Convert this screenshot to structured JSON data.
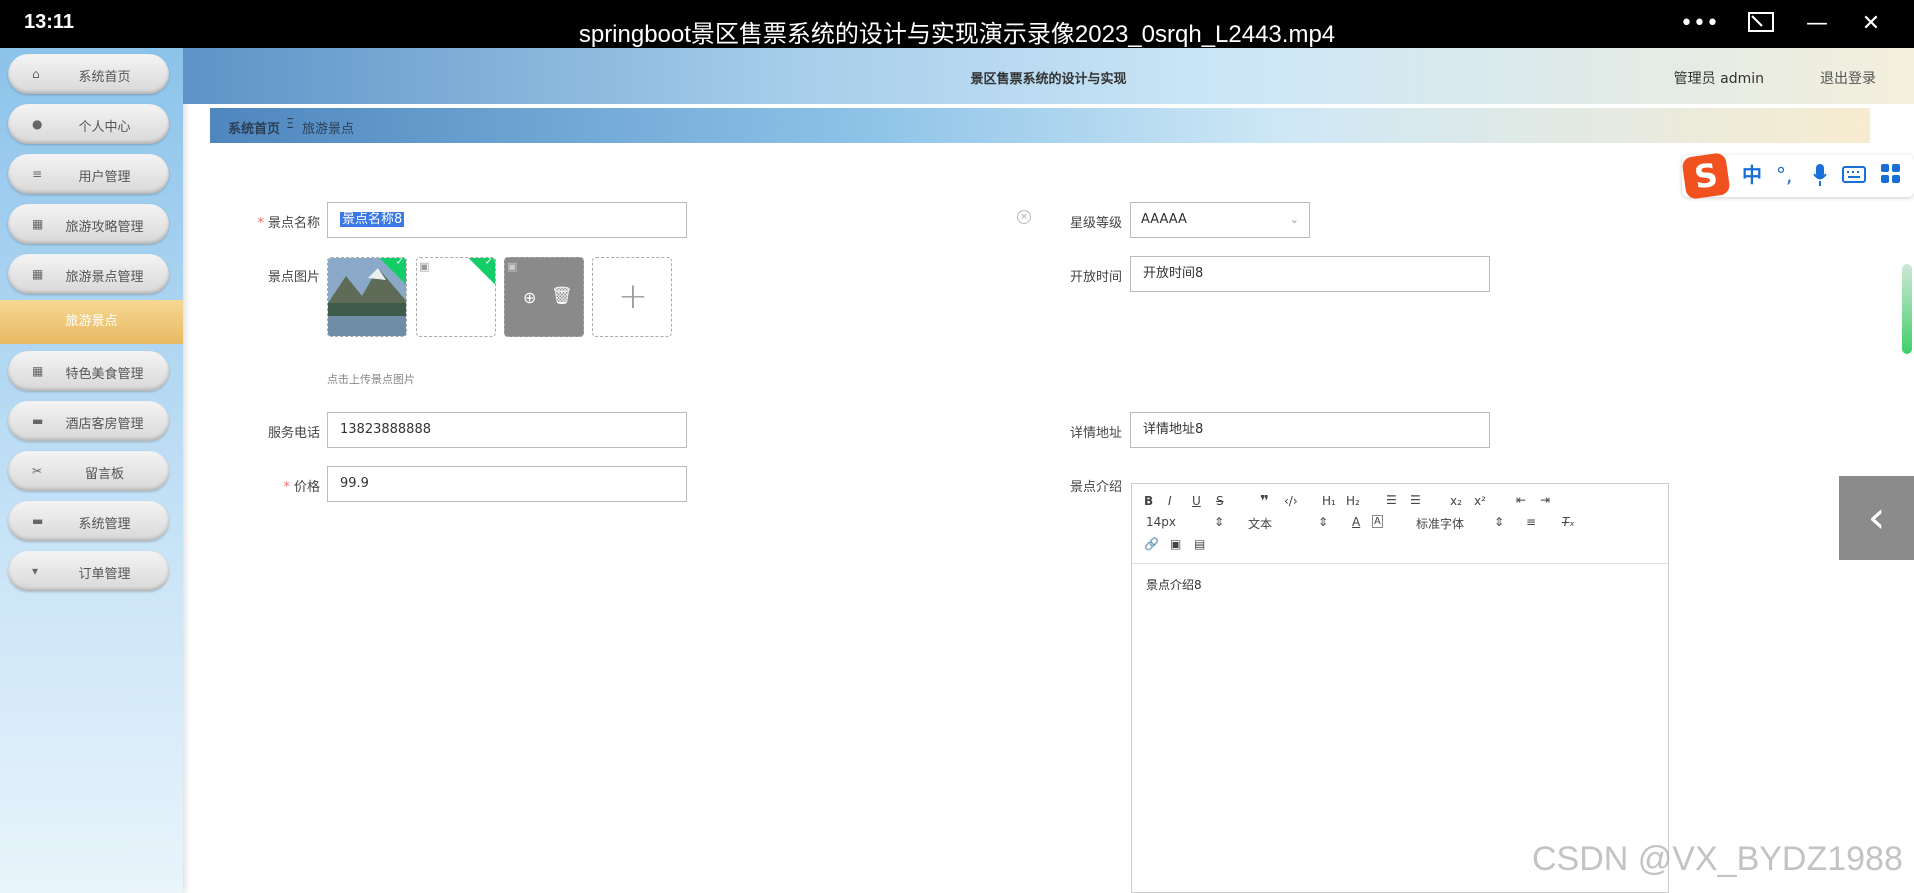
{
  "player": {
    "time": "13:11",
    "title": "springboot景区售票系统的设计与实现演示录像2023_0srqh_L2443.mp4"
  },
  "sidebar": {
    "items": [
      {
        "label": "系统首页",
        "icon": "home-icon"
      },
      {
        "label": "个人中心",
        "icon": "user-icon"
      },
      {
        "label": "用户管理",
        "icon": "list-icon"
      },
      {
        "label": "旅游攻略管理",
        "icon": "grid-icon"
      },
      {
        "label": "旅游景点管理",
        "icon": "grid-icon"
      },
      {
        "label": "特色美食管理",
        "icon": "grid-icon"
      },
      {
        "label": "酒店客房管理",
        "icon": "monitor-icon"
      },
      {
        "label": "留言板",
        "icon": "ticket-icon"
      },
      {
        "label": "系统管理",
        "icon": "monitor-icon"
      },
      {
        "label": "订单管理",
        "icon": "sign-icon"
      }
    ],
    "active_sub": "旅游景点"
  },
  "header": {
    "title": "景区售票系统的设计与实现",
    "admin": "管理员 admin",
    "logout": "退出登录"
  },
  "breadcrumb": {
    "home": "系统首页",
    "sep": "Ξ",
    "current": "旅游景点"
  },
  "form": {
    "name": {
      "label": "景点名称",
      "value": "景点名称8"
    },
    "images": {
      "label": "景点图片",
      "hint": "点击上传景点图片"
    },
    "phone": {
      "label": "服务电话",
      "value": "13823888888"
    },
    "price": {
      "label": "价格",
      "value": "99.9"
    },
    "star": {
      "label": "星级等级",
      "value": "AAAAA"
    },
    "open_time": {
      "label": "开放时间",
      "value": "开放时间8"
    },
    "address": {
      "label": "详情地址",
      "value": "详情地址8"
    },
    "intro": {
      "label": "景点介绍",
      "value": "景点介绍8"
    }
  },
  "editor": {
    "font_size": "14px",
    "text_type": "文本",
    "font_family": "标准字体"
  },
  "ime": {
    "lang": "中"
  },
  "watermark": "CSDN @VX_BYDZ1988",
  "colors": {
    "accent": "#13ce66",
    "required": "#f56c6c",
    "active_menu": "#e8b962"
  }
}
